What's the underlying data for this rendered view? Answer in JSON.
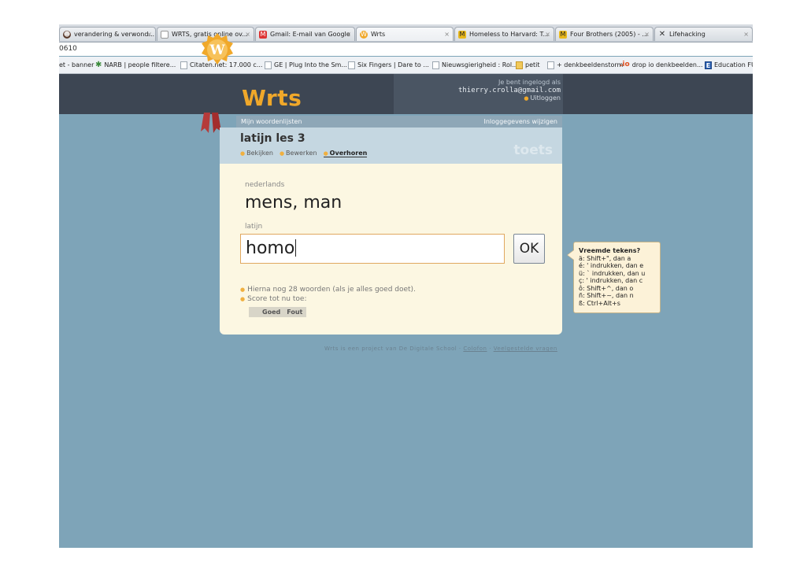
{
  "browser": {
    "tabs": [
      {
        "label": "verandering & verwond...",
        "icon": "smiley-icon"
      },
      {
        "label": "WRTS, gratis online ov...",
        "icon": "page-icon"
      },
      {
        "label": "Gmail: E-mail van Google",
        "icon": "gmail-icon"
      },
      {
        "label": "Wrts",
        "icon": "wrts-icon"
      },
      {
        "label": "Homeless to Harvard: T...",
        "icon": "imdb-icon"
      },
      {
        "label": "Four Brothers (2005) - ...",
        "icon": "imdb-icon"
      },
      {
        "label": "Lifehacking",
        "icon": "lifehacking-icon"
      }
    ],
    "address_fragment": "0610",
    "bookmarks": [
      {
        "label": "et - banner",
        "icon": "page-icon"
      },
      {
        "label": "NARB | people filtere...",
        "icon": "star-icon"
      },
      {
        "label": "Citaten.net: 17.000 c...",
        "icon": "page-icon"
      },
      {
        "label": "GE | Plug Into the Sm...",
        "icon": "page-icon"
      },
      {
        "label": "Six Fingers | Dare to ...",
        "icon": "page-icon"
      },
      {
        "label": "Nieuwsgierigheid : Rol...",
        "icon": "page-icon"
      },
      {
        "label": "petit",
        "icon": "folder-icon"
      },
      {
        "label": "+ denkbeeldenstorm",
        "icon": "page-icon"
      },
      {
        "label": "drop io denkbeelden...",
        "icon": "dropio-icon"
      },
      {
        "label": "Education FU",
        "icon": "e-icon"
      }
    ]
  },
  "header": {
    "brand": "Wrts",
    "login_text": "Je bent ingelogd als",
    "email": "thierry.crolla@gmail.com",
    "logout": "Uitloggen",
    "accent": "#f0a82a"
  },
  "subnav": {
    "left": "Mijn woordenlijsten",
    "right": "Inloggegevens wijzigen"
  },
  "list": {
    "title": "latijn les 3",
    "badge": "toets",
    "tabs": [
      "Bekijken",
      "Bewerken",
      "Overhoren"
    ],
    "active_tab": "Overhoren"
  },
  "quiz": {
    "question_label": "nederlands",
    "question": "mens, man",
    "answer_label": "latijn",
    "answer_value": "homo",
    "ok_label": "OK",
    "remaining": "Hierna nog 28 woorden (als je alles goed doet).",
    "score_label": "Score tot nu toe:",
    "score_good": "Goed",
    "score_bad": "Fout"
  },
  "tooltip": {
    "title": "Vreemde tekens?",
    "lines": [
      "ä: Shift+\", dan a",
      "é: ' indrukken, dan e",
      "ü: ` indrukken, dan u",
      "ç: ' indrukken, dan c",
      "ô: Shift+^, dan o",
      "ñ: Shift+~, dan n",
      "ß: Ctrl+Alt+s"
    ]
  },
  "footer": {
    "text": "Wrts is een project van De Digitale School ·",
    "colofon": "Colofon",
    "sep": "·",
    "faq": "Veelgestelde vragen"
  }
}
